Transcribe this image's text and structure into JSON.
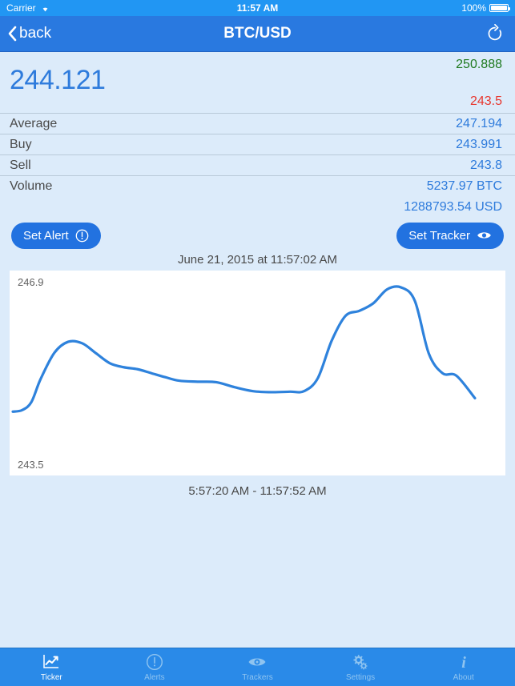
{
  "status_bar": {
    "carrier": "Carrier",
    "wifi_icon": "wifi-icon",
    "time": "11:57 AM",
    "battery_percent": "100%",
    "battery_icon": "battery-icon"
  },
  "nav_bar": {
    "back_icon": "chevron-left-icon",
    "back_label": "back",
    "title": "BTC/USD",
    "refresh_icon": "refresh-icon"
  },
  "ticker": {
    "price": "244.121",
    "high": "250.888",
    "low": "243.5",
    "rows": [
      {
        "label": "Average",
        "value": "247.194"
      },
      {
        "label": "Buy",
        "value": "243.991"
      },
      {
        "label": "Sell",
        "value": "243.8"
      },
      {
        "label": "Volume",
        "value": "5237.97 BTC"
      }
    ],
    "volume_secondary": "1288793.54 USD"
  },
  "actions": {
    "set_alert_label": "Set Alert",
    "set_alert_icon": "exclamation-circle-icon",
    "set_tracker_label": "Set Tracker",
    "set_tracker_icon": "eye-icon"
  },
  "chart_meta": {
    "timestamp": "June 21, 2015 at 11:57:02 AM",
    "range": "5:57:20 AM - 11:57:52 AM"
  },
  "chart_data": {
    "type": "line",
    "title": "June 21, 2015 at 11:57:02 AM",
    "xlabel": "5:57:20 AM - 11:57:52 AM",
    "ylabel": "",
    "grid": false,
    "legend": false,
    "line_color": "#2e82dc",
    "ylim": [
      243.5,
      246.9
    ],
    "ytick_labels": [
      "246.9",
      "243.5"
    ],
    "xlim_labels": [
      "5:57:20 AM",
      "11:57:52 AM"
    ],
    "x": [
      0,
      2,
      4,
      6,
      9,
      12,
      15,
      18,
      21,
      24,
      27,
      30,
      33,
      36,
      40,
      44,
      48,
      52,
      56,
      60,
      63,
      66,
      69,
      72,
      75,
      78,
      81,
      84,
      87,
      90,
      93,
      96,
      100
    ],
    "values": [
      244.33,
      244.36,
      244.52,
      244.98,
      245.51,
      245.73,
      245.7,
      245.5,
      245.3,
      245.22,
      245.18,
      245.1,
      245.02,
      244.95,
      244.93,
      244.92,
      244.82,
      244.74,
      244.72,
      244.73,
      244.74,
      245.0,
      245.75,
      246.25,
      246.35,
      246.5,
      246.78,
      246.82,
      246.55,
      245.5,
      245.1,
      245.05,
      244.6
    ]
  },
  "tab_bar": {
    "items": [
      {
        "label": "Ticker",
        "icon": "line-chart-icon",
        "active": true
      },
      {
        "label": "Alerts",
        "icon": "exclamation-circle-icon",
        "active": false
      },
      {
        "label": "Trackers",
        "icon": "eye-icon",
        "active": false
      },
      {
        "label": "Settings",
        "icon": "gears-icon",
        "active": false
      },
      {
        "label": "About",
        "icon": "info-icon",
        "active": false
      }
    ]
  },
  "colors": {
    "accent_blue": "#2272e0",
    "nav_blue": "#2979e0",
    "tab_blue": "#2a8ae8",
    "background": "#dcebfa",
    "price_blue": "#2e7bdc",
    "high_green": "#1f7a1f",
    "low_red": "#e8352c"
  }
}
